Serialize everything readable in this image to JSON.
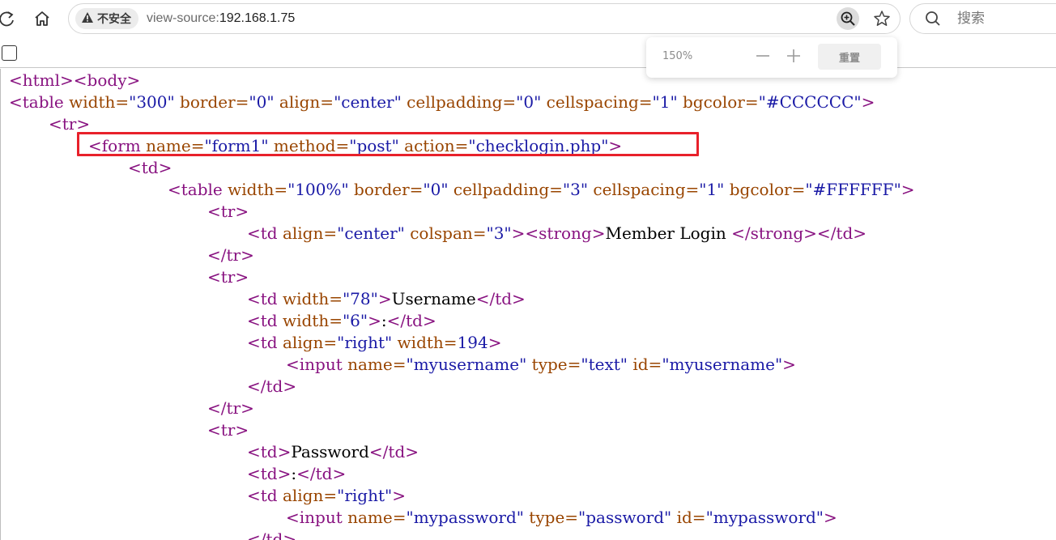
{
  "toolbar": {
    "security_label": "不安全",
    "url_scheme": "view-source:",
    "url_host": "192.168.1.75",
    "search_placeholder": "搜索"
  },
  "zoom_popup": {
    "percent": "150%",
    "reset_label": "重置"
  },
  "source_lines": [
    [
      [
        "t",
        "<html><body>"
      ]
    ],
    [
      [
        "t",
        "<table"
      ],
      [
        "a",
        " width="
      ],
      [
        "v",
        "\"300\""
      ],
      [
        "a",
        " border="
      ],
      [
        "v",
        "\"0\""
      ],
      [
        "a",
        " align="
      ],
      [
        "v",
        "\"center\""
      ],
      [
        "a",
        " cellpadding="
      ],
      [
        "v",
        "\"0\""
      ],
      [
        "a",
        " cellspacing="
      ],
      [
        "v",
        "\"1\""
      ],
      [
        "a",
        " bgcolor="
      ],
      [
        "v",
        "\"#CCCCCC\""
      ],
      [
        "t",
        ">"
      ]
    ],
    [
      [
        "t",
        "<tr>"
      ]
    ],
    [
      [
        "t",
        "<form"
      ],
      [
        "a",
        " name="
      ],
      [
        "v",
        "\"form1\""
      ],
      [
        "a",
        " method="
      ],
      [
        "v",
        "\"post\""
      ],
      [
        "a",
        " action="
      ],
      [
        "v",
        "\"checklogin.php\""
      ],
      [
        "t",
        ">"
      ]
    ],
    [
      [
        "t",
        "<td>"
      ]
    ],
    [
      [
        "t",
        "<table"
      ],
      [
        "a",
        " width="
      ],
      [
        "v",
        "\"100%\""
      ],
      [
        "a",
        " border="
      ],
      [
        "v",
        "\"0\""
      ],
      [
        "a",
        " cellpadding="
      ],
      [
        "v",
        "\"3\""
      ],
      [
        "a",
        " cellspacing="
      ],
      [
        "v",
        "\"1\""
      ],
      [
        "a",
        " bgcolor="
      ],
      [
        "v",
        "\"#FFFFFF\""
      ],
      [
        "t",
        ">"
      ]
    ],
    [
      [
        "t",
        "<tr>"
      ]
    ],
    [
      [
        "t",
        "<td"
      ],
      [
        "a",
        " align="
      ],
      [
        "v",
        "\"center\""
      ],
      [
        "a",
        " colspan="
      ],
      [
        "v",
        "\"3\""
      ],
      [
        "t",
        "><strong>"
      ],
      [
        "x",
        "Member Login "
      ],
      [
        "t",
        "</strong></td>"
      ]
    ],
    [
      [
        "t",
        "</tr>"
      ]
    ],
    [
      [
        "t",
        "<tr>"
      ]
    ],
    [
      [
        "t",
        "<td"
      ],
      [
        "a",
        " width="
      ],
      [
        "v",
        "\"78\""
      ],
      [
        "t",
        ">"
      ],
      [
        "x",
        "Username"
      ],
      [
        "t",
        "</td>"
      ]
    ],
    [
      [
        "t",
        "<td"
      ],
      [
        "a",
        " width="
      ],
      [
        "v",
        "\"6\""
      ],
      [
        "t",
        ">"
      ],
      [
        "x",
        ":"
      ],
      [
        "t",
        "</td>"
      ]
    ],
    [
      [
        "t",
        "<td"
      ],
      [
        "a",
        " align="
      ],
      [
        "v",
        "\"right\""
      ],
      [
        "a",
        " width="
      ],
      [
        "v",
        "194"
      ],
      [
        "t",
        ">"
      ]
    ],
    [
      [
        "t",
        "<input"
      ],
      [
        "a",
        " name="
      ],
      [
        "v",
        "\"myusername\""
      ],
      [
        "a",
        " type="
      ],
      [
        "v",
        "\"text\""
      ],
      [
        "a",
        " id="
      ],
      [
        "v",
        "\"myusername\""
      ],
      [
        "t",
        ">"
      ]
    ],
    [
      [
        "t",
        "</td>"
      ]
    ],
    [
      [
        "t",
        "</tr>"
      ]
    ],
    [
      [
        "t",
        "<tr>"
      ]
    ],
    [
      [
        "t",
        "<td>"
      ],
      [
        "x",
        "Password"
      ],
      [
        "t",
        "</td>"
      ]
    ],
    [
      [
        "t",
        "<td>"
      ],
      [
        "x",
        ":"
      ],
      [
        "t",
        "</td>"
      ]
    ],
    [
      [
        "t",
        "<td"
      ],
      [
        "a",
        " align="
      ],
      [
        "v",
        "\"right\""
      ],
      [
        "t",
        ">"
      ]
    ],
    [
      [
        "t",
        "<input"
      ],
      [
        "a",
        " name="
      ],
      [
        "v",
        "\"mypassword\""
      ],
      [
        "a",
        " type="
      ],
      [
        "v",
        "\"password\""
      ],
      [
        "a",
        " id="
      ],
      [
        "v",
        "\"mypassword\""
      ],
      [
        "t",
        ">"
      ]
    ],
    [
      [
        "t",
        "</td>"
      ]
    ]
  ]
}
